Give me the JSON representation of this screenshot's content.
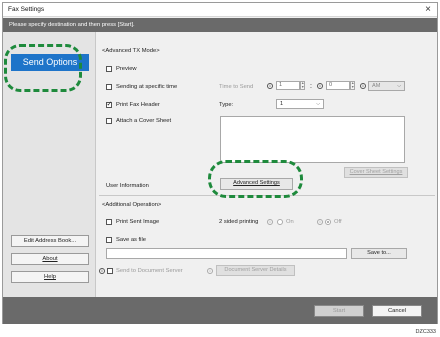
{
  "window": {
    "title": "Fax Settings",
    "close_glyph": "×",
    "instruction": "Please specify destination and then press [Start]."
  },
  "sidebar": {
    "active_tab": "Send Options",
    "buttons": [
      {
        "label": "Edit Address Book..."
      },
      {
        "label": "About"
      },
      {
        "label": "Help"
      }
    ]
  },
  "advanced_tx": {
    "section_label": "<Advanced TX Mode>",
    "preview_label": "Preview",
    "preview_checked": false,
    "sending_time_label": "Sending at specific time",
    "sending_time_checked": false,
    "time_to_send_label": "Time to Send",
    "hour_value": "1",
    "colon": ":",
    "minute_value": "0",
    "ampm_value": "AM",
    "print_header_label": "Print Fax Header",
    "print_header_checked": true,
    "type_label": "Type:",
    "type_value": "1",
    "cover_sheet_label": "Attach a Cover Sheet",
    "cover_sheet_checked": false,
    "cover_sheet_settings_label": "Cover Sheet Settings",
    "user_information_label": "User Information",
    "advanced_settings_label": "Advanced Settings"
  },
  "additional": {
    "section_label": "<Additional Operation>",
    "print_sent_label": "Print Sent Image",
    "print_sent_checked": false,
    "two_sided_label": "2 sided printing",
    "on_label": "On",
    "off_label": "Off",
    "two_sided_selected": "Off",
    "save_as_file_label": "Save as file",
    "save_as_file_checked": false,
    "save_path_value": "",
    "save_to_label": "Save to...",
    "send_to_server_label": "Send to Document Server",
    "send_to_server_checked": false,
    "server_details_label": "Document Server Details"
  },
  "footer": {
    "start_label": "Start",
    "cancel_label": "Cancel"
  },
  "figure_ref": "DZC333",
  "colors": {
    "accent_blue": "#1e74c9",
    "bar_gray": "#6a6a6a",
    "highlight_dash": "#1e8a3c"
  },
  "icons": {
    "info": "info-circle-icon",
    "close": "close-icon",
    "dropdown": "chevron-down-icon"
  }
}
